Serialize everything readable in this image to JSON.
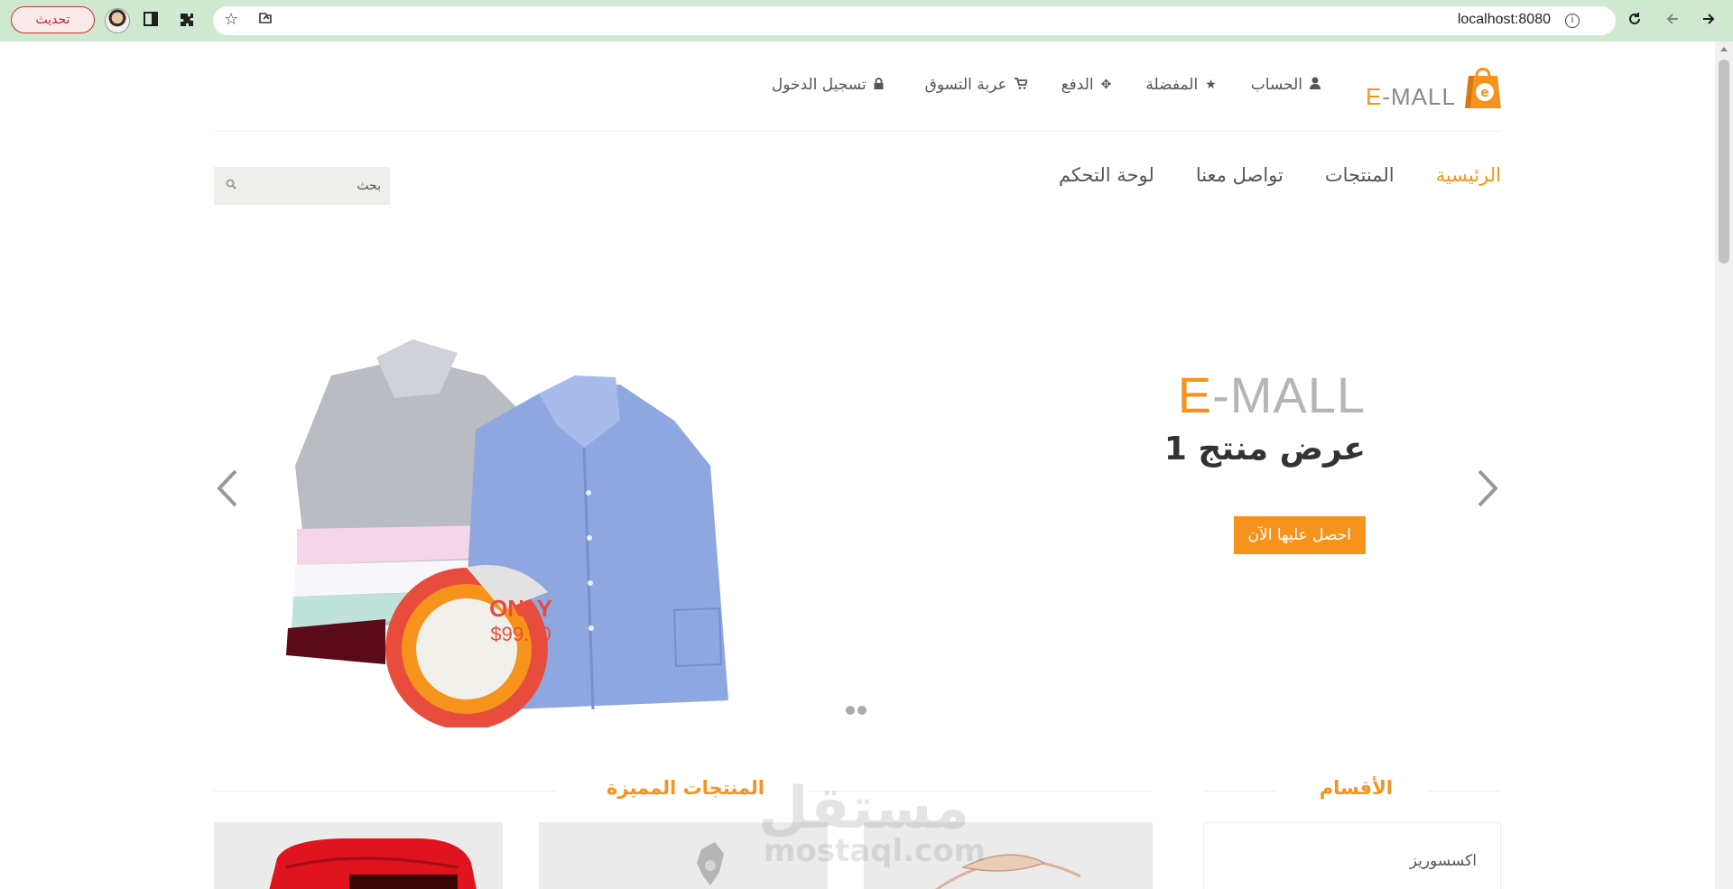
{
  "browser": {
    "update_label": "تحديث",
    "url": "localhost:8080"
  },
  "brand": {
    "logo_prefix": "E",
    "logo_suffix": "-MALL",
    "colors": {
      "accent": "#f6931d",
      "text": "#555555",
      "chrome": "#cfe8d0"
    }
  },
  "top_links": [
    {
      "label": "الحساب",
      "icon": "user-icon"
    },
    {
      "label": "المفضلة",
      "icon": "star-icon"
    },
    {
      "label": "الدفع",
      "icon": "crosshair-icon"
    },
    {
      "label": "عربة التسوق",
      "icon": "cart-icon"
    },
    {
      "label": "تسجيل الدخول",
      "icon": "lock-icon"
    }
  ],
  "nav": {
    "items": [
      {
        "label": "الرئيسية",
        "active": true
      },
      {
        "label": "المنتجات",
        "active": false
      },
      {
        "label": "تواصل معنا",
        "active": false
      },
      {
        "label": "لوحة التحكم",
        "active": false
      }
    ],
    "search_placeholder": "بحث"
  },
  "slider": {
    "brand_prefix": "E",
    "brand_suffix": "-MALL",
    "title": "عرض منتج 1",
    "cta": "احصل عليها الآن",
    "badge_top": "ONLY",
    "badge_price": "$99.00",
    "slide_count": 2
  },
  "sections": {
    "categories_title": "الأقسام",
    "featured_title": "المنتجات المميزة",
    "categories": [
      "اكسسوريز"
    ]
  },
  "watermark": {
    "arabic": "مستقل",
    "latin": "mostaql.com"
  }
}
